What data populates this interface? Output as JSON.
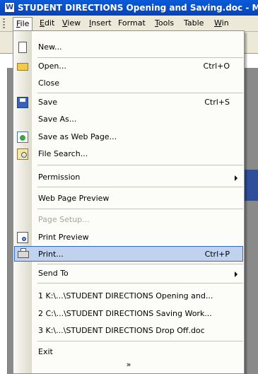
{
  "window": {
    "title": "STUDENT DIRECTIONS Opening and Saving.doc - Micro"
  },
  "menubar": [
    {
      "label": "File",
      "active": true
    },
    {
      "label": "Edit"
    },
    {
      "label": "View"
    },
    {
      "label": "Insert"
    },
    {
      "label": "Format"
    },
    {
      "label": "Tools"
    },
    {
      "label": "Table"
    },
    {
      "label": "Win"
    }
  ],
  "file_menu": {
    "items": {
      "new": {
        "label": "New...",
        "icon": "new-document-icon"
      },
      "open": {
        "label": "Open...",
        "shortcut": "Ctrl+O",
        "icon": "open-folder-icon"
      },
      "close": {
        "label": "Close"
      },
      "save": {
        "label": "Save",
        "shortcut": "Ctrl+S",
        "icon": "save-disk-icon"
      },
      "save_as": {
        "label": "Save As..."
      },
      "save_web": {
        "label": "Save as Web Page...",
        "icon": "web-page-icon"
      },
      "file_search": {
        "label": "File Search...",
        "icon": "file-search-icon"
      },
      "permission": {
        "label": "Permission"
      },
      "web_preview": {
        "label": "Web Page Preview"
      },
      "page_setup": {
        "label": "Page Setup...",
        "disabled": true
      },
      "print_preview": {
        "label": "Print Preview",
        "icon": "print-preview-icon"
      },
      "print": {
        "label": "Print...",
        "shortcut": "Ctrl+P",
        "icon": "printer-icon",
        "highlighted": true
      },
      "send_to": {
        "label": "Send To"
      },
      "recent1": {
        "label": "1 K:\\...\\STUDENT DIRECTIONS Opening and..."
      },
      "recent2": {
        "label": "2 C:\\...\\STUDENT DIRECTIONS Saving Work..."
      },
      "recent3": {
        "label": "3 K:\\...\\STUDENT DIRECTIONS Drop Off.doc"
      },
      "exit": {
        "label": "Exit"
      }
    },
    "expand_glyph": "»"
  },
  "colors": {
    "highlight": "#c1d2ee",
    "highlight_border": "#316ac5",
    "titlebar": "#0a5bd8"
  }
}
